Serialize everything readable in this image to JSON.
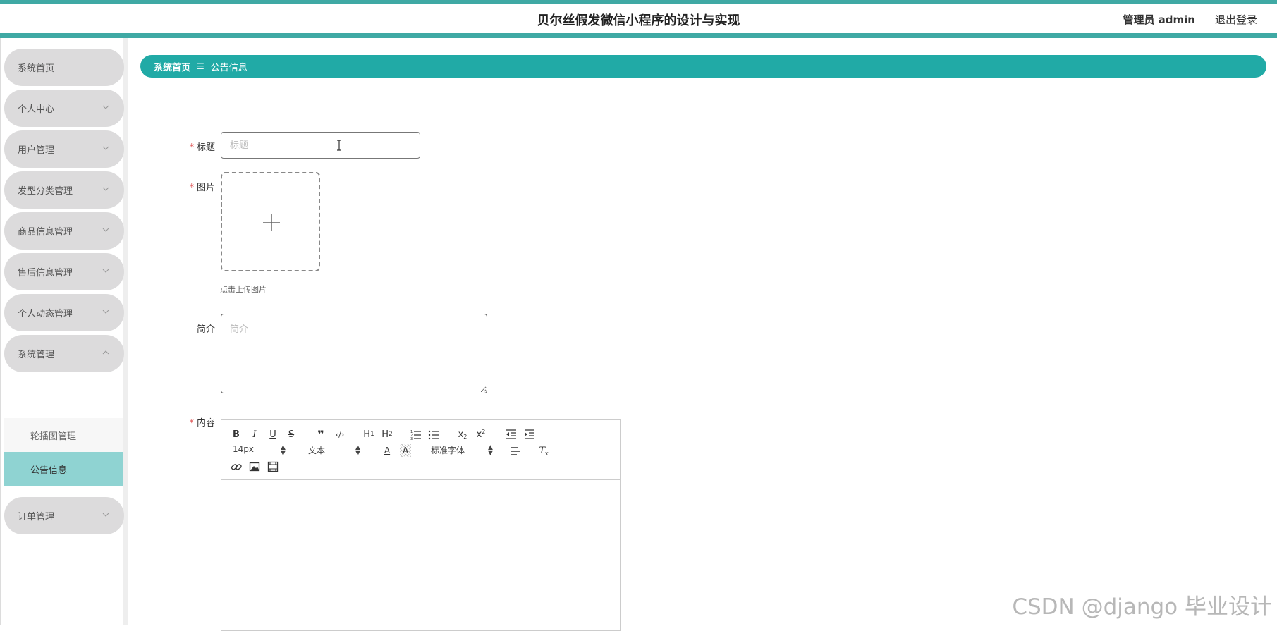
{
  "header": {
    "title": "贝尔丝假发微信小程序的设计与实现",
    "user_label": "管理员 admin",
    "logout_label": "退出登录"
  },
  "sidebar": {
    "items": [
      {
        "label": "系统首页",
        "has_chevron": false
      },
      {
        "label": "个人中心",
        "has_chevron": true
      },
      {
        "label": "用户管理",
        "has_chevron": true
      },
      {
        "label": "发型分类管理",
        "has_chevron": true
      },
      {
        "label": "商品信息管理",
        "has_chevron": true
      },
      {
        "label": "售后信息管理",
        "has_chevron": true
      },
      {
        "label": "个人动态管理",
        "has_chevron": true
      },
      {
        "label": "系统管理",
        "has_chevron": true,
        "expanded": true
      },
      {
        "label": "订单管理",
        "has_chevron": true
      }
    ],
    "sub_items": [
      {
        "label": "轮播图管理",
        "active": false
      },
      {
        "label": "公告信息",
        "active": true
      }
    ]
  },
  "breadcrumb": {
    "home": "系统首页",
    "separator_icon": "menu-icon",
    "current": "公告信息"
  },
  "form": {
    "title_label": "标题",
    "title_placeholder": "标题",
    "title_value": "",
    "image_label": "图片",
    "upload_hint": "点击上传图片",
    "intro_label": "简介",
    "intro_placeholder": "简介",
    "content_label": "内容"
  },
  "editor": {
    "font_size": "14px",
    "header_picker": "文本",
    "font_family": "标准字体",
    "tools": [
      "bold-icon",
      "italic-icon",
      "underline-icon",
      "strike-icon",
      "blockquote-icon",
      "code-icon",
      "h1-icon",
      "h2-icon",
      "ordered-list-icon",
      "bullet-list-icon",
      "subscript-icon",
      "superscript-icon",
      "outdent-icon",
      "indent-icon",
      "font-color-icon",
      "background-color-icon",
      "align-icon",
      "clear-format-icon",
      "link-icon",
      "image-icon",
      "video-icon"
    ]
  },
  "colors": {
    "accent": "#21aaa6",
    "header_line": "#3fa9a4",
    "sidebar_item": "#dcdbdc",
    "sidebar_active": "#8fd3d2",
    "required": "#e05a5a"
  },
  "watermark": "CSDN @django 毕业设计"
}
